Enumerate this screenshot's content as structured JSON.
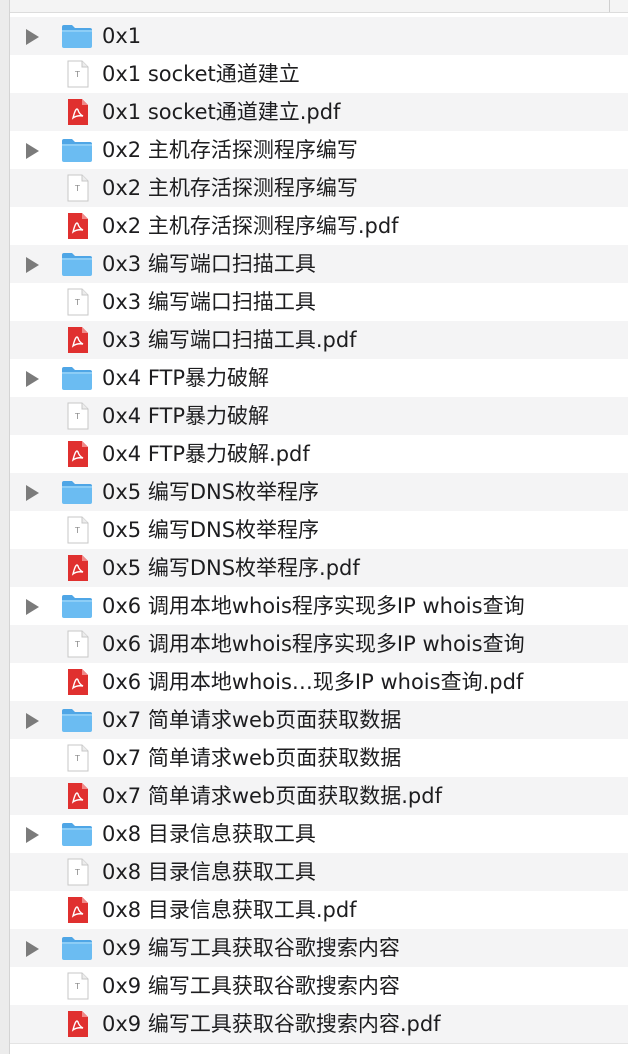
{
  "items": [
    {
      "kind": "folder",
      "label": "0x1",
      "expanded": false
    },
    {
      "kind": "text",
      "label": "0x1 socket通道建立"
    },
    {
      "kind": "pdf",
      "label": "0x1 socket通道建立.pdf"
    },
    {
      "kind": "folder",
      "label": "0x2 主机存活探测程序编写",
      "expanded": false
    },
    {
      "kind": "text",
      "label": "0x2 主机存活探测程序编写"
    },
    {
      "kind": "pdf",
      "label": "0x2 主机存活探测程序编写.pdf"
    },
    {
      "kind": "folder",
      "label": "0x3 编写端口扫描工具",
      "expanded": false
    },
    {
      "kind": "text",
      "label": "0x3 编写端口扫描工具"
    },
    {
      "kind": "pdf",
      "label": "0x3 编写端口扫描工具.pdf"
    },
    {
      "kind": "folder",
      "label": "0x4 FTP暴力破解",
      "expanded": false
    },
    {
      "kind": "text",
      "label": "0x4 FTP暴力破解"
    },
    {
      "kind": "pdf",
      "label": "0x4 FTP暴力破解.pdf"
    },
    {
      "kind": "folder",
      "label": "0x5 编写DNS枚举程序",
      "expanded": false
    },
    {
      "kind": "text",
      "label": "0x5 编写DNS枚举程序"
    },
    {
      "kind": "pdf",
      "label": "0x5 编写DNS枚举程序.pdf"
    },
    {
      "kind": "folder",
      "label": "0x6 调用本地whois程序实现多IP whois查询",
      "expanded": false
    },
    {
      "kind": "text",
      "label": "0x6 调用本地whois程序实现多IP whois查询"
    },
    {
      "kind": "pdf",
      "label": "0x6 调用本地whois…现多IP whois查询.pdf"
    },
    {
      "kind": "folder",
      "label": "0x7 简单请求web页面获取数据",
      "expanded": false
    },
    {
      "kind": "text",
      "label": "0x7 简单请求web页面获取数据"
    },
    {
      "kind": "pdf",
      "label": "0x7 简单请求web页面获取数据.pdf"
    },
    {
      "kind": "folder",
      "label": "0x8 目录信息获取工具",
      "expanded": false
    },
    {
      "kind": "text",
      "label": "0x8 目录信息获取工具"
    },
    {
      "kind": "pdf",
      "label": "0x8 目录信息获取工具.pdf"
    },
    {
      "kind": "folder",
      "label": "0x9 编写工具获取谷歌搜索内容",
      "expanded": false
    },
    {
      "kind": "text",
      "label": "0x9 编写工具获取谷歌搜索内容"
    },
    {
      "kind": "pdf",
      "label": "0x9 编写工具获取谷歌搜索内容.pdf"
    }
  ],
  "icons": {
    "folder": "folder-icon",
    "text": "text-document-icon",
    "pdf": "pdf-document-icon",
    "toggle": "disclosure-triangle-icon"
  },
  "colors": {
    "folder": "#5fb4ef",
    "pdf": "#e0302f",
    "row_alt": "#f4f4f5",
    "text": "#1d1d1f",
    "toggle": "#7b7b7b"
  }
}
